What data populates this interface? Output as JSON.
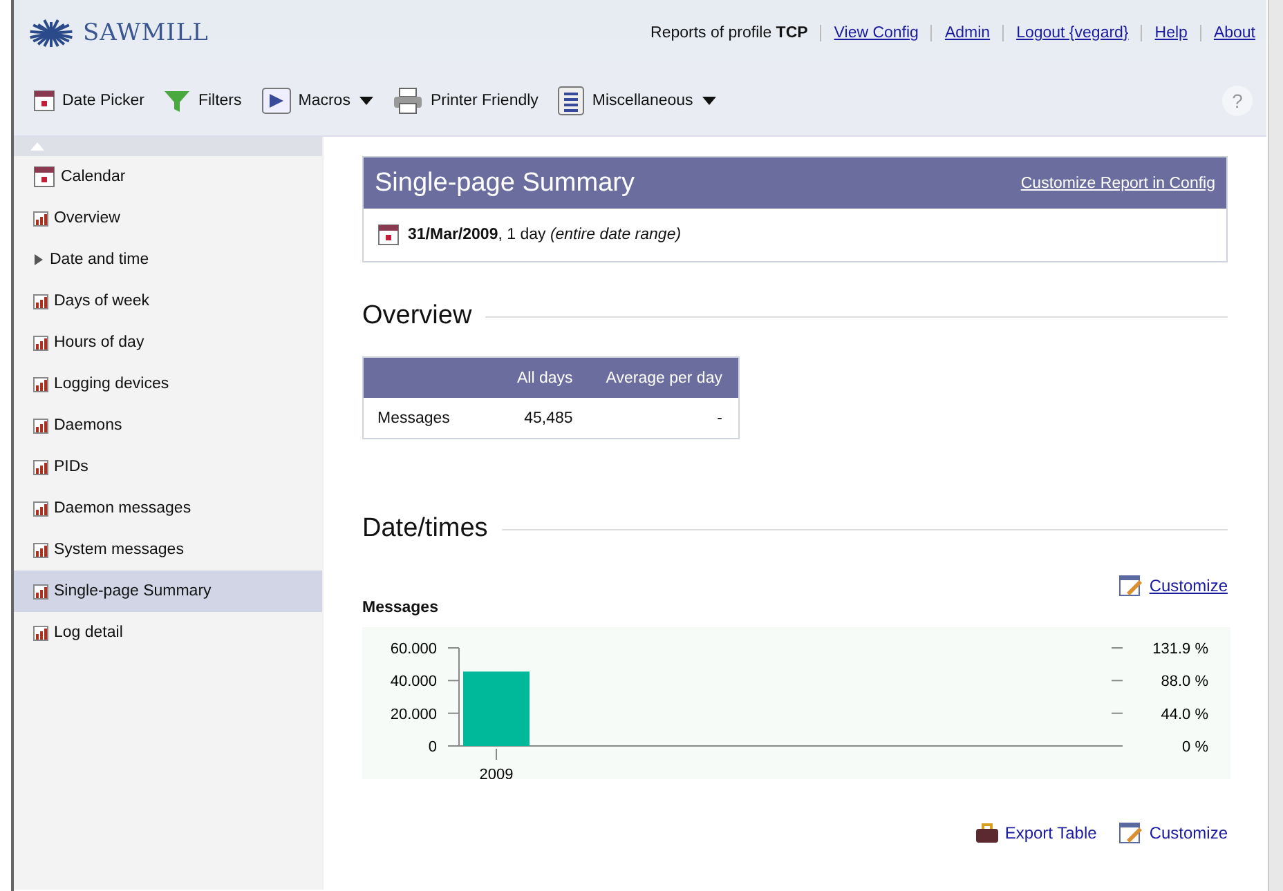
{
  "header": {
    "logo": "SAWMILL",
    "profile_label": "Reports of profile",
    "profile": "TCP",
    "links": [
      "View Config",
      "Admin",
      "Logout {vegard}",
      "Help",
      "About"
    ]
  },
  "toolbar": [
    {
      "kind": "calendar",
      "label": "Date Picker",
      "dropdown": false
    },
    {
      "kind": "filter",
      "label": "Filters",
      "dropdown": false
    },
    {
      "kind": "play",
      "label": "Macros",
      "dropdown": true
    },
    {
      "kind": "printer",
      "label": "Printer Friendly",
      "dropdown": false
    },
    {
      "kind": "list",
      "label": "Miscellaneous",
      "dropdown": true
    }
  ],
  "help": "?",
  "sidebar": {
    "items": [
      {
        "kind": "calendar",
        "label": "Calendar",
        "selected": false
      },
      {
        "kind": "report",
        "label": "Overview",
        "selected": false
      },
      {
        "kind": "group",
        "label": "Date and time",
        "selected": false
      },
      {
        "kind": "report",
        "label": "Days of week",
        "selected": false
      },
      {
        "kind": "report",
        "label": "Hours of day",
        "selected": false
      },
      {
        "kind": "report",
        "label": "Logging devices",
        "selected": false
      },
      {
        "kind": "report",
        "label": "Daemons",
        "selected": false
      },
      {
        "kind": "report",
        "label": "PIDs",
        "selected": false
      },
      {
        "kind": "report",
        "label": "Daemon messages",
        "selected": false
      },
      {
        "kind": "report",
        "label": "System messages",
        "selected": false
      },
      {
        "kind": "report",
        "label": "Single-page Summary",
        "selected": true
      },
      {
        "kind": "report",
        "label": "Log detail",
        "selected": false
      }
    ]
  },
  "report": {
    "title": "Single-page Summary",
    "customize_link": "Customize Report in Config",
    "date_line": "**31/Mar/2009**, 1 day *(entire date range)*"
  },
  "overview": {
    "heading": "Overview",
    "columns": [
      "",
      "All days",
      "Average per day"
    ],
    "rows": [
      [
        "Messages",
        "45,485",
        "-"
      ]
    ]
  },
  "datetimes": {
    "heading": "Date/times",
    "customize": "Customize",
    "chart_data": {
      "type": "bar",
      "categories": [
        "2009"
      ],
      "series": [
        {
          "name": "Messages",
          "color": "#00b89a",
          "values": [
            45.5
          ]
        }
      ],
      "ylim": [
        0,
        60
      ],
      "yticks": [
        {
          "value": 0,
          "label": "0"
        },
        {
          "value": 20,
          "label": "20.000"
        },
        {
          "value": 40,
          "label": "40.000"
        },
        {
          "value": 60,
          "label": "60.000"
        }
      ]
    },
    "right_axis_labels": [
      "131.9 %",
      "88.0 %",
      "44.0 %",
      "0 %"
    ],
    "actions": [
      {
        "kind": "export",
        "label": "Export Table"
      },
      {
        "kind": "customize",
        "label": "Customize"
      }
    ]
  }
}
